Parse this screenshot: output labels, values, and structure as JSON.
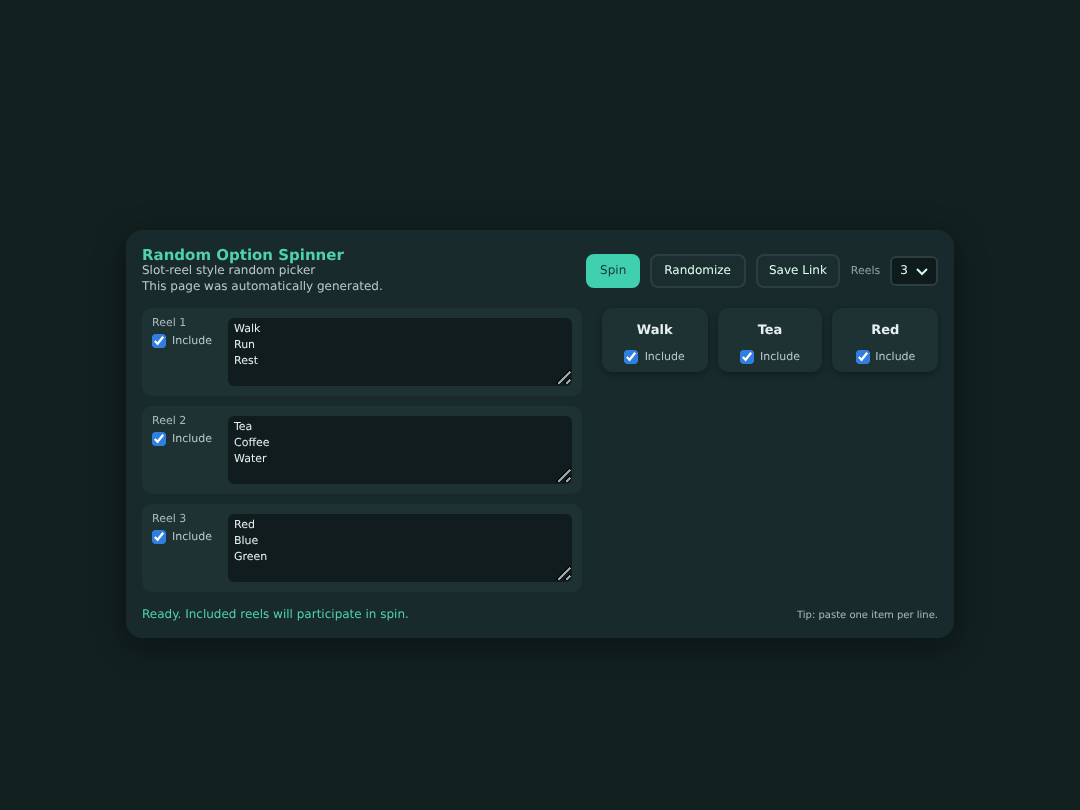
{
  "title": "Random Option Spinner",
  "subtitle": "Slot-reel style random picker",
  "note": "This page was automatically generated.",
  "buttons": [
    {
      "label": "Spin",
      "kind": "primary"
    },
    {
      "label": "Randomize",
      "kind": "plain"
    },
    {
      "label": "Save Link",
      "kind": "plain"
    }
  ],
  "reels_select": {
    "label": "Reels",
    "value": "3"
  },
  "reels": [
    {
      "label": "Reel 1",
      "include_label": "Include",
      "checked": true,
      "value": "Walk\nRun\nRest"
    },
    {
      "label": "Reel 2",
      "include_label": "Include",
      "checked": true,
      "value": "Tea\nCoffee\nWater"
    },
    {
      "label": "Reel 3",
      "include_label": "Include",
      "checked": true,
      "value": "Red\nBlue\nGreen"
    }
  ],
  "results": [
    {
      "value": "Walk",
      "include_label": "Include",
      "checked": true
    },
    {
      "value": "Tea",
      "include_label": "Include",
      "checked": true
    },
    {
      "value": "Red",
      "include_label": "Include",
      "checked": true
    }
  ],
  "status": "Ready. Included reels will participate in spin.",
  "tip": "Tip: paste one item per line."
}
